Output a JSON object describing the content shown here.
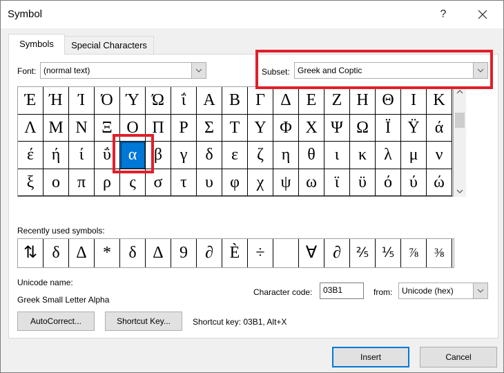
{
  "window": {
    "title": "Symbol",
    "help_label": "?",
    "close_icon": "close-icon"
  },
  "tabs": [
    {
      "label": "Symbols",
      "active": true
    },
    {
      "label": "Special Characters",
      "active": false
    }
  ],
  "font": {
    "label": "Font:",
    "value": "(normal text)"
  },
  "subset": {
    "label": "Subset:",
    "value": "Greek and Coptic"
  },
  "symbols_grid": {
    "rows": [
      [
        "Έ",
        "Ή",
        "Ί",
        "Ό",
        "Ύ",
        "Ώ",
        "ΐ",
        "Α",
        "Β",
        "Γ",
        "Δ",
        "Ε",
        "Ζ",
        "Η",
        "Θ",
        "Ι",
        "Κ"
      ],
      [
        "Λ",
        "Μ",
        "Ν",
        "Ξ",
        "Ο",
        "Π",
        "Ρ",
        "Σ",
        "Τ",
        "Υ",
        "Φ",
        "Χ",
        "Ψ",
        "Ω",
        "Ϊ",
        "Ϋ",
        "ά"
      ],
      [
        "έ",
        "ή",
        "ί",
        "ΰ",
        "α",
        "β",
        "γ",
        "δ",
        "ε",
        "ζ",
        "η",
        "θ",
        "ι",
        "κ",
        "λ",
        "μ",
        "ν"
      ],
      [
        "ξ",
        "ο",
        "π",
        "ρ",
        "ς",
        "σ",
        "τ",
        "υ",
        "φ",
        "χ",
        "ψ",
        "ω",
        "ϊ",
        "ϋ",
        "ό",
        "ύ",
        "ώ"
      ]
    ],
    "selected": "α"
  },
  "recently_used": {
    "label": "Recently used symbols:",
    "items": [
      "⇅",
      "δ",
      "Δ",
      "*",
      "δ",
      "Δ",
      "9",
      "∂",
      "È",
      "÷",
      " ",
      "∀",
      "∂",
      "⅖",
      "⅕",
      "⅞",
      "⅜"
    ]
  },
  "unicode_name": {
    "label": "Unicode name:",
    "value": "Greek Small Letter Alpha"
  },
  "character_code": {
    "label": "Character code:",
    "value": "03B1"
  },
  "from": {
    "label": "from:",
    "value": "Unicode (hex)"
  },
  "buttons": {
    "autocorrect": "AutoCorrect...",
    "shortcut_key": "Shortcut Key...",
    "insert": "Insert",
    "cancel": "Cancel"
  },
  "shortcut_info": "Shortcut key: 03B1, Alt+X",
  "colors": {
    "accent": "#0078d7",
    "highlight": "#e01f2a"
  }
}
